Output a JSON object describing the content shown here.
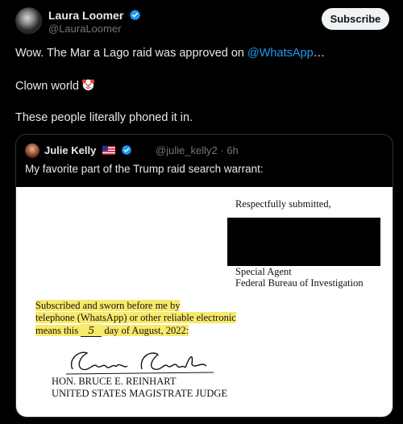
{
  "post": {
    "author_name": "Laura Loomer",
    "author_handle": "@LauraLoomer",
    "subscribe_label": "Subscribe",
    "line1_prefix": "Wow. The Mar a Lago raid was approved on ",
    "line1_mention": "@WhatsApp",
    "line1_suffix": "…",
    "line2": "Clown world",
    "line3": "These people literally phoned it in."
  },
  "quote": {
    "author_name": "Julie Kelly",
    "author_handle": "@julie_kelly2",
    "time_sep": " · ",
    "time": "6h",
    "text": "My favorite part of the Trump raid search warrant:"
  },
  "document": {
    "respectfully": "Respectfully submitted,",
    "agent_title": "Special Agent",
    "agency": "Federal Bureau of Investigation",
    "sworn_line1": "Subscribed and sworn before me by",
    "sworn_line2": "telephone (WhatsApp) or other reliable electronic",
    "sworn_line3_a": "means this ",
    "sworn_day": "5",
    "sworn_line3_b": " day of August, 2022:",
    "judge_name": "HON. BRUCE E. REINHART",
    "judge_title": "UNITED STATES MAGISTRATE JUDGE"
  },
  "colors": {
    "background": "#000000",
    "link": "#1d9bf0",
    "verified": "#1d9bf0",
    "highlight": "#f7e96a"
  },
  "icons": {
    "verified": "verified-badge-icon",
    "clown": "clown-face-emoji",
    "flag": "us-flag-emoji"
  }
}
